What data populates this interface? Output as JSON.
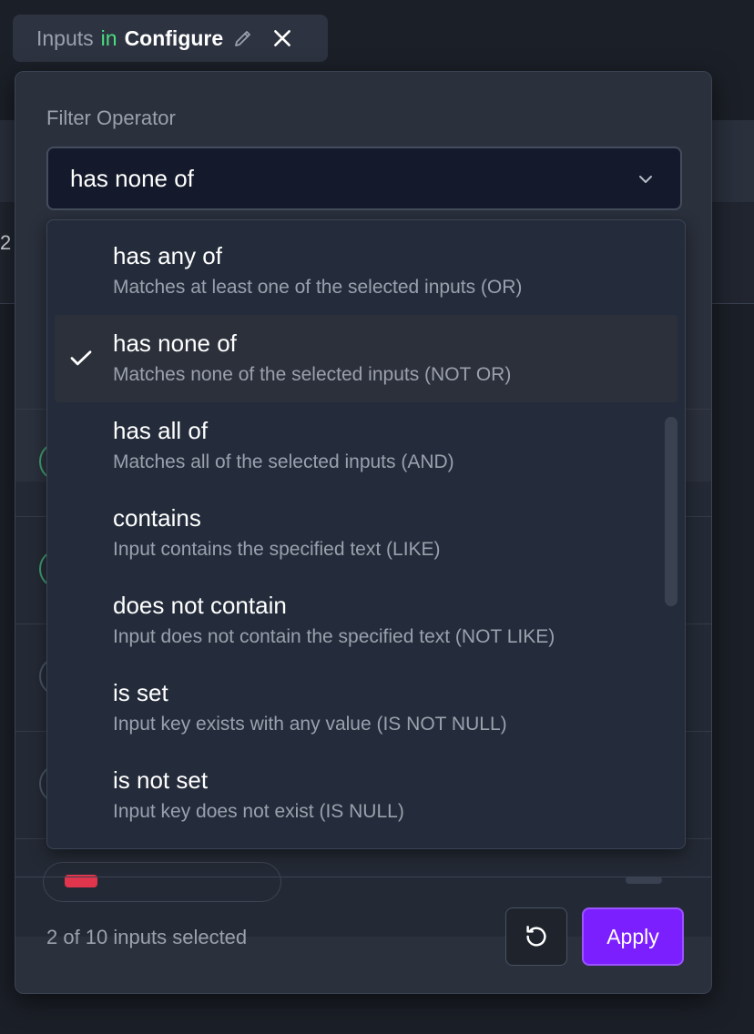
{
  "chip": {
    "field": "Inputs",
    "connector": "in",
    "value": "Configure",
    "edit_icon": "pencil-icon",
    "close_icon": "close-icon"
  },
  "background": {
    "partial_number": "2"
  },
  "filter": {
    "label": "Filter Operator",
    "selected": "has none of",
    "chevron_icon": "chevron-down-icon"
  },
  "options": [
    {
      "title": "has any of",
      "description": "Matches at least one of the selected inputs (OR)"
    },
    {
      "title": "has none of",
      "description": "Matches none of the selected inputs (NOT OR)",
      "selected": true
    },
    {
      "title": "has all of",
      "description": "Matches all of the selected inputs (AND)"
    },
    {
      "title": "contains",
      "description": "Input contains the specified text (LIKE)"
    },
    {
      "title": "does not contain",
      "description": "Input does not contain the specified text (NOT LIKE)"
    },
    {
      "title": "is set",
      "description": "Input key exists with any value (IS NOT NULL)"
    },
    {
      "title": "is not set",
      "description": "Input key does not exist (IS NULL)"
    }
  ],
  "footer": {
    "count_text": "2 of 10 inputs selected",
    "reset_icon": "reset-icon",
    "apply_label": "Apply"
  },
  "colors": {
    "accent": "#7c1fff",
    "connector_green": "#4ade80",
    "panel": "#2a303c",
    "menu": "#242c3b"
  }
}
